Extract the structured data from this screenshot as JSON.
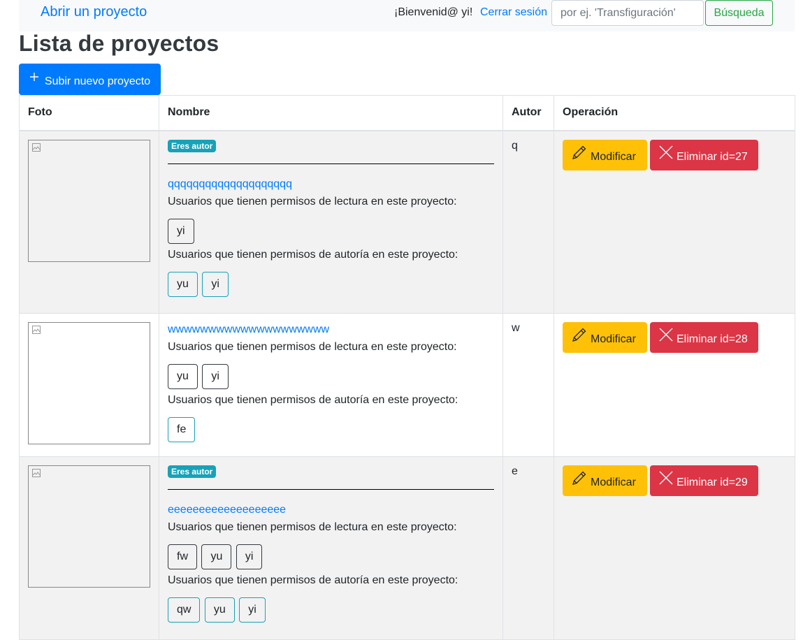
{
  "navbar": {
    "brand": "Abrir un proyecto",
    "welcome": "¡Bienvenid@ yi!",
    "logout": "Cerrar sesión",
    "search_placeholder": "por ej. 'Transfiguración'",
    "search_button": "Búsqueda"
  },
  "page": {
    "title": "Lista de proyectos",
    "upload_button": "Subir nuevo proyecto"
  },
  "table": {
    "headers": [
      "Foto",
      "Nombre",
      "Autor",
      "Operación"
    ],
    "read_label": "Usuarios que tienen permisos de lectura en este proyecto:",
    "author_label": "Usuarios que tienen permisos de autoría en este proyecto:",
    "badge": "Eres autor",
    "modify_label": "Modificar",
    "rows": [
      {
        "is_author": true,
        "name": "qqqqqqqqqqqqqqqqqqqq",
        "author": "q",
        "readers": [
          "yi"
        ],
        "authors": [
          "yu",
          "yi"
        ],
        "delete_label": "Eliminar id=27"
      },
      {
        "is_author": false,
        "name": "wwwwwwwwwwwwwwwwwwww",
        "author": "w",
        "readers": [
          "yu",
          "yi"
        ],
        "authors": [
          "fe"
        ],
        "delete_label": "Eliminar id=28"
      },
      {
        "is_author": true,
        "name": "eeeeeeeeeeeeeeeeeee",
        "author": "e",
        "readers": [
          "fw",
          "yu",
          "yi"
        ],
        "authors": [
          "qw",
          "yu",
          "yi"
        ],
        "delete_label": "Eliminar id=29"
      }
    ]
  },
  "colors": {
    "primary": "#007bff",
    "success": "#28a745",
    "warning": "#ffc107",
    "danger": "#dc3545",
    "info": "#17a2b8",
    "stripe": "#f2f2f2"
  },
  "icons": {
    "upload": "plus-icon",
    "modify": "pencil-icon",
    "delete": "x-icon",
    "thumbnail": "broken-image-icon"
  }
}
